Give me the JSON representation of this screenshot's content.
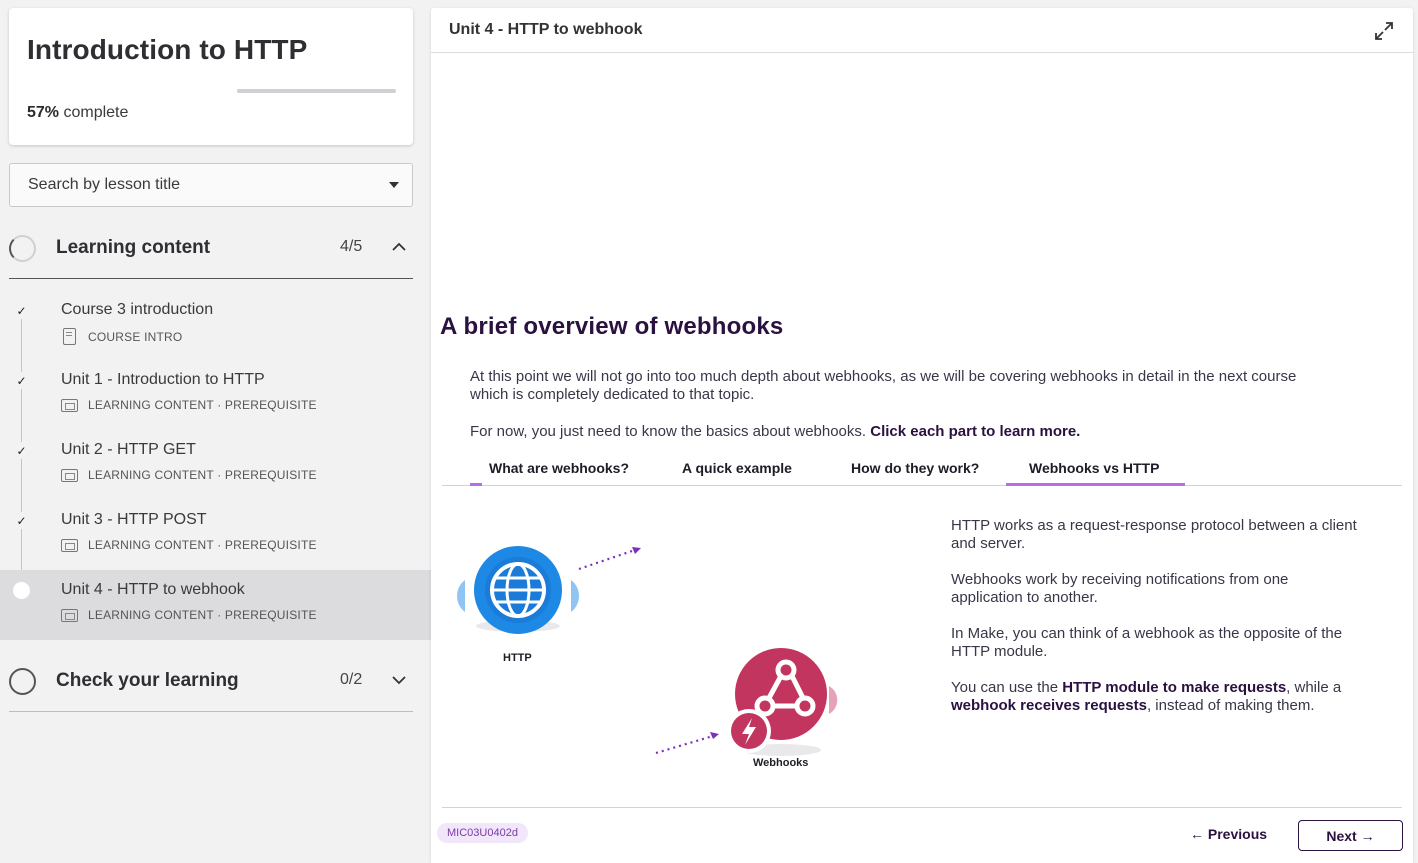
{
  "course": {
    "title": "Introduction to HTTP",
    "progress_pct": "57%",
    "progress_suffix": " complete",
    "progress_value": 0.57
  },
  "search": {
    "placeholder": "Search by lesson title"
  },
  "sections": [
    {
      "label": "Learning content",
      "count": "4/5",
      "expanded": true
    },
    {
      "label": "Check your learning",
      "count": "0/2",
      "expanded": false
    }
  ],
  "lessons": [
    {
      "title": "Course 3 introduction",
      "meta": "COURSE INTRO",
      "done": true,
      "icon": "document-icon"
    },
    {
      "title": "Unit 1 - Introduction to HTTP",
      "meta": "LEARNING CONTENT · PREREQUISITE",
      "done": true,
      "icon": "slides-icon"
    },
    {
      "title": "Unit 2 - HTTP GET",
      "meta": "LEARNING CONTENT · PREREQUISITE",
      "done": true,
      "icon": "slides-icon"
    },
    {
      "title": "Unit 3 - HTTP POST",
      "meta": "LEARNING CONTENT · PREREQUISITE",
      "done": true,
      "icon": "slides-icon"
    },
    {
      "title": "Unit 4 - HTTP to webhook",
      "meta": "LEARNING CONTENT · PREREQUISITE",
      "done": false,
      "active": true,
      "icon": "slides-icon"
    }
  ],
  "main": {
    "header_title": "Unit 4 - HTTP to webhook",
    "heading": "A brief overview of webhooks",
    "intro": "At this point we will not go into too much depth about webhooks, as we will be covering webhooks in detail in the next course which is completely dedicated to that topic.",
    "intro2_plain": "For now, you just need to know the basics about webhooks. ",
    "intro2_bold": "Click each part to learn more.",
    "tabs": [
      "What are webhooks?",
      "A quick example",
      "How do they work?",
      "Webhooks vs HTTP"
    ],
    "active_tab": "Webhooks vs HTTP",
    "diagram": {
      "http_label": "HTTP",
      "webhooks_label": "Webhooks"
    },
    "body": {
      "p1": "HTTP works as a request-response protocol between a client and server.",
      "p2": "Webhooks work by receiving notifications from one application to another.",
      "p3": "In Make, you can think of a webhook as the opposite of the HTTP module.",
      "p4_a": "You can use the ",
      "p4_b": "HTTP module to make requests",
      "p4_c": ", while a ",
      "p4_d": "webhook receives requests",
      "p4_e": ", instead of making them."
    },
    "footer": {
      "code": "MIC03U0402d",
      "previous": "← Previous",
      "next": "Next →"
    }
  },
  "colors": {
    "accent": "#b66ee4",
    "heading": "#2a1140",
    "http_blue": "#1e88e5",
    "webhook_pink": "#c2355f"
  }
}
